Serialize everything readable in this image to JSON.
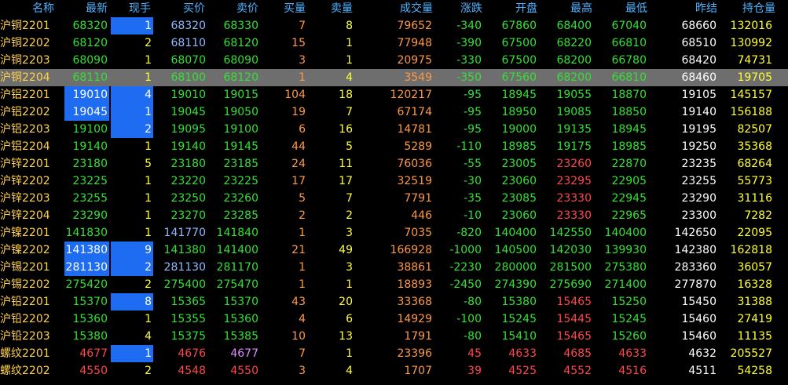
{
  "columns": [
    "名称",
    "最新",
    "现手",
    "买价",
    "卖价",
    "买量",
    "卖量",
    "成交量",
    "涨跌",
    "开盘",
    "最高",
    "最低",
    "昨结",
    "持仓量"
  ],
  "colors": {
    "name": "#ffd24a",
    "header": "#4fb2ff",
    "green": "#34e034",
    "red": "#ff4747",
    "yellow": "#ffff33",
    "orange": "#ff9944",
    "blue": "#90b8ff",
    "white": "#ffffff",
    "purple": "#dd88ff",
    "selected_row_bg": "#6e6e6e",
    "highlight_bg": "#1e6cf1"
  },
  "rows": [
    {
      "name": "沪铜2201",
      "latest": "68320",
      "hand": "1",
      "bid": "68320",
      "ask": "68330",
      "bidvol": "7",
      "askvol": "8",
      "volume": "79652",
      "chg": "-340",
      "open": "67860",
      "high": "68400",
      "low": "67040",
      "prev": "68660",
      "oi": "132016"
    },
    {
      "name": "沪铜2202",
      "latest": "68120",
      "hand": "2",
      "bid": "68110",
      "ask": "68120",
      "bidvol": "15",
      "askvol": "1",
      "volume": "77948",
      "chg": "-390",
      "open": "67500",
      "high": "68220",
      "low": "66810",
      "prev": "68510",
      "oi": "130992"
    },
    {
      "name": "沪铜2203",
      "latest": "68090",
      "hand": "1",
      "bid": "68070",
      "ask": "68090",
      "bidvol": "3",
      "askvol": "1",
      "volume": "20975",
      "chg": "-330",
      "open": "67500",
      "high": "68200",
      "low": "66780",
      "prev": "68420",
      "oi": "74731"
    },
    {
      "name": "沪铜2204",
      "latest": "68110",
      "hand": "1",
      "bid": "68100",
      "ask": "68120",
      "bidvol": "1",
      "askvol": "4",
      "volume": "3549",
      "chg": "-350",
      "open": "67560",
      "high": "68200",
      "low": "66810",
      "prev": "68460",
      "oi": "19705"
    },
    {
      "name": "沪铝2201",
      "latest": "19010",
      "hand": "4",
      "bid": "19010",
      "ask": "19015",
      "bidvol": "104",
      "askvol": "18",
      "volume": "120217",
      "chg": "-95",
      "open": "18945",
      "high": "19055",
      "low": "18870",
      "prev": "19105",
      "oi": "145157"
    },
    {
      "name": "沪铝2202",
      "latest": "19045",
      "hand": "1",
      "bid": "19045",
      "ask": "19050",
      "bidvol": "19",
      "askvol": "7",
      "volume": "67174",
      "chg": "-95",
      "open": "18950",
      "high": "19085",
      "low": "18850",
      "prev": "19140",
      "oi": "156188"
    },
    {
      "name": "沪铝2203",
      "latest": "19100",
      "hand": "2",
      "bid": "19095",
      "ask": "19100",
      "bidvol": "6",
      "askvol": "16",
      "volume": "14781",
      "chg": "-95",
      "open": "19000",
      "high": "19135",
      "low": "18945",
      "prev": "19195",
      "oi": "82507"
    },
    {
      "name": "沪铝2204",
      "latest": "19140",
      "hand": "1",
      "bid": "19140",
      "ask": "19145",
      "bidvol": "44",
      "askvol": "5",
      "volume": "5289",
      "chg": "-110",
      "open": "18985",
      "high": "19175",
      "low": "18985",
      "prev": "19250",
      "oi": "35368"
    },
    {
      "name": "沪锌2201",
      "latest": "23180",
      "hand": "5",
      "bid": "23180",
      "ask": "23185",
      "bidvol": "24",
      "askvol": "11",
      "volume": "76036",
      "chg": "-55",
      "open": "23005",
      "high": "23260",
      "low": "22870",
      "prev": "23235",
      "oi": "68264"
    },
    {
      "name": "沪锌2202",
      "latest": "23225",
      "hand": "1",
      "bid": "23220",
      "ask": "23225",
      "bidvol": "17",
      "askvol": "17",
      "volume": "32519",
      "chg": "-30",
      "open": "23060",
      "high": "23295",
      "low": "22905",
      "prev": "23255",
      "oi": "55773"
    },
    {
      "name": "沪锌2203",
      "latest": "23255",
      "hand": "1",
      "bid": "23250",
      "ask": "23260",
      "bidvol": "5",
      "askvol": "7",
      "volume": "7791",
      "chg": "-35",
      "open": "23085",
      "high": "23330",
      "low": "22945",
      "prev": "23290",
      "oi": "31116"
    },
    {
      "name": "沪锌2204",
      "latest": "23290",
      "hand": "1",
      "bid": "23270",
      "ask": "23285",
      "bidvol": "2",
      "askvol": "2",
      "volume": "446",
      "chg": "-10",
      "open": "23060",
      "high": "23330",
      "low": "22965",
      "prev": "23300",
      "oi": "7282"
    },
    {
      "name": "沪镍2201",
      "latest": "141830",
      "hand": "1",
      "bid": "141770",
      "ask": "141840",
      "bidvol": "1",
      "askvol": "3",
      "volume": "7035",
      "chg": "-820",
      "open": "140400",
      "high": "142550",
      "low": "140400",
      "prev": "142650",
      "oi": "22095"
    },
    {
      "name": "沪镍2202",
      "latest": "141380",
      "hand": "9",
      "bid": "141380",
      "ask": "141400",
      "bidvol": "21",
      "askvol": "49",
      "volume": "166928",
      "chg": "-1000",
      "open": "140500",
      "high": "142030",
      "low": "139930",
      "prev": "142380",
      "oi": "162818"
    },
    {
      "name": "沪锡2201",
      "latest": "281130",
      "hand": "2",
      "bid": "281130",
      "ask": "281170",
      "bidvol": "1",
      "askvol": "3",
      "volume": "38861",
      "chg": "-2230",
      "open": "280000",
      "high": "281500",
      "low": "275380",
      "prev": "283360",
      "oi": "36057"
    },
    {
      "name": "沪锡2202",
      "latest": "275420",
      "hand": "2",
      "bid": "275400",
      "ask": "275470",
      "bidvol": "1",
      "askvol": "1",
      "volume": "18893",
      "chg": "-2450",
      "open": "274390",
      "high": "275690",
      "low": "271400",
      "prev": "277870",
      "oi": "16328"
    },
    {
      "name": "沪铅2201",
      "latest": "15370",
      "hand": "8",
      "bid": "15365",
      "ask": "15370",
      "bidvol": "43",
      "askvol": "20",
      "volume": "33368",
      "chg": "-80",
      "open": "15380",
      "high": "15465",
      "low": "15250",
      "prev": "15450",
      "oi": "31388"
    },
    {
      "name": "沪铅2202",
      "latest": "15360",
      "hand": "1",
      "bid": "15355",
      "ask": "15360",
      "bidvol": "4",
      "askvol": "6",
      "volume": "14929",
      "chg": "-100",
      "open": "15245",
      "high": "15445",
      "low": "15245",
      "prev": "15460",
      "oi": "27419"
    },
    {
      "name": "沪铅2203",
      "latest": "15380",
      "hand": "4",
      "bid": "15375",
      "ask": "15385",
      "bidvol": "10",
      "askvol": "13",
      "volume": "1791",
      "chg": "-80",
      "open": "15410",
      "high": "15465",
      "low": "15260",
      "prev": "15460",
      "oi": "11135"
    },
    {
      "name": "螺纹2201",
      "latest": "4677",
      "hand": "1",
      "bid": "4676",
      "ask": "4677",
      "bidvol": "7",
      "askvol": "1",
      "volume": "23396",
      "chg": "45",
      "open": "4633",
      "high": "4685",
      "low": "4633",
      "prev": "4632",
      "oi": "205527"
    },
    {
      "name": "螺纹2202",
      "latest": "4550",
      "hand": "2",
      "bid": "4548",
      "ask": "4550",
      "bidvol": "3",
      "askvol": "4",
      "volume": "1707",
      "chg": "39",
      "open": "4525",
      "high": "4552",
      "low": "4516",
      "prev": "4511",
      "oi": "54258"
    }
  ]
}
